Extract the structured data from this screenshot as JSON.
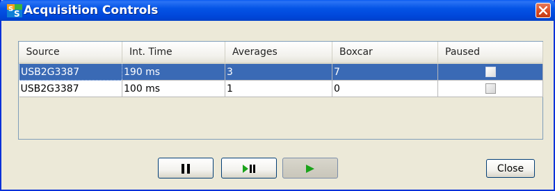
{
  "window": {
    "title": "Acquisition Controls"
  },
  "table": {
    "columns": [
      "Source",
      "Int. Time",
      "Averages",
      "Boxcar",
      "Paused"
    ],
    "rows": [
      {
        "source": "USB2G3387",
        "int_time": "190 ms",
        "averages": "3",
        "boxcar": "7",
        "paused": false,
        "selected": true
      },
      {
        "source": "USB2G3387",
        "int_time": "100 ms",
        "averages": "1",
        "boxcar": "0",
        "paused": false,
        "selected": false
      }
    ]
  },
  "buttons": {
    "pause_icon": "pause-icon",
    "step_icon": "step-play-pause-icon",
    "play_icon": "play-icon",
    "close_label": "Close"
  },
  "colors": {
    "title_bar": "#0454e6",
    "selection": "#3a6ab5",
    "play_green": "#1aa31a"
  }
}
